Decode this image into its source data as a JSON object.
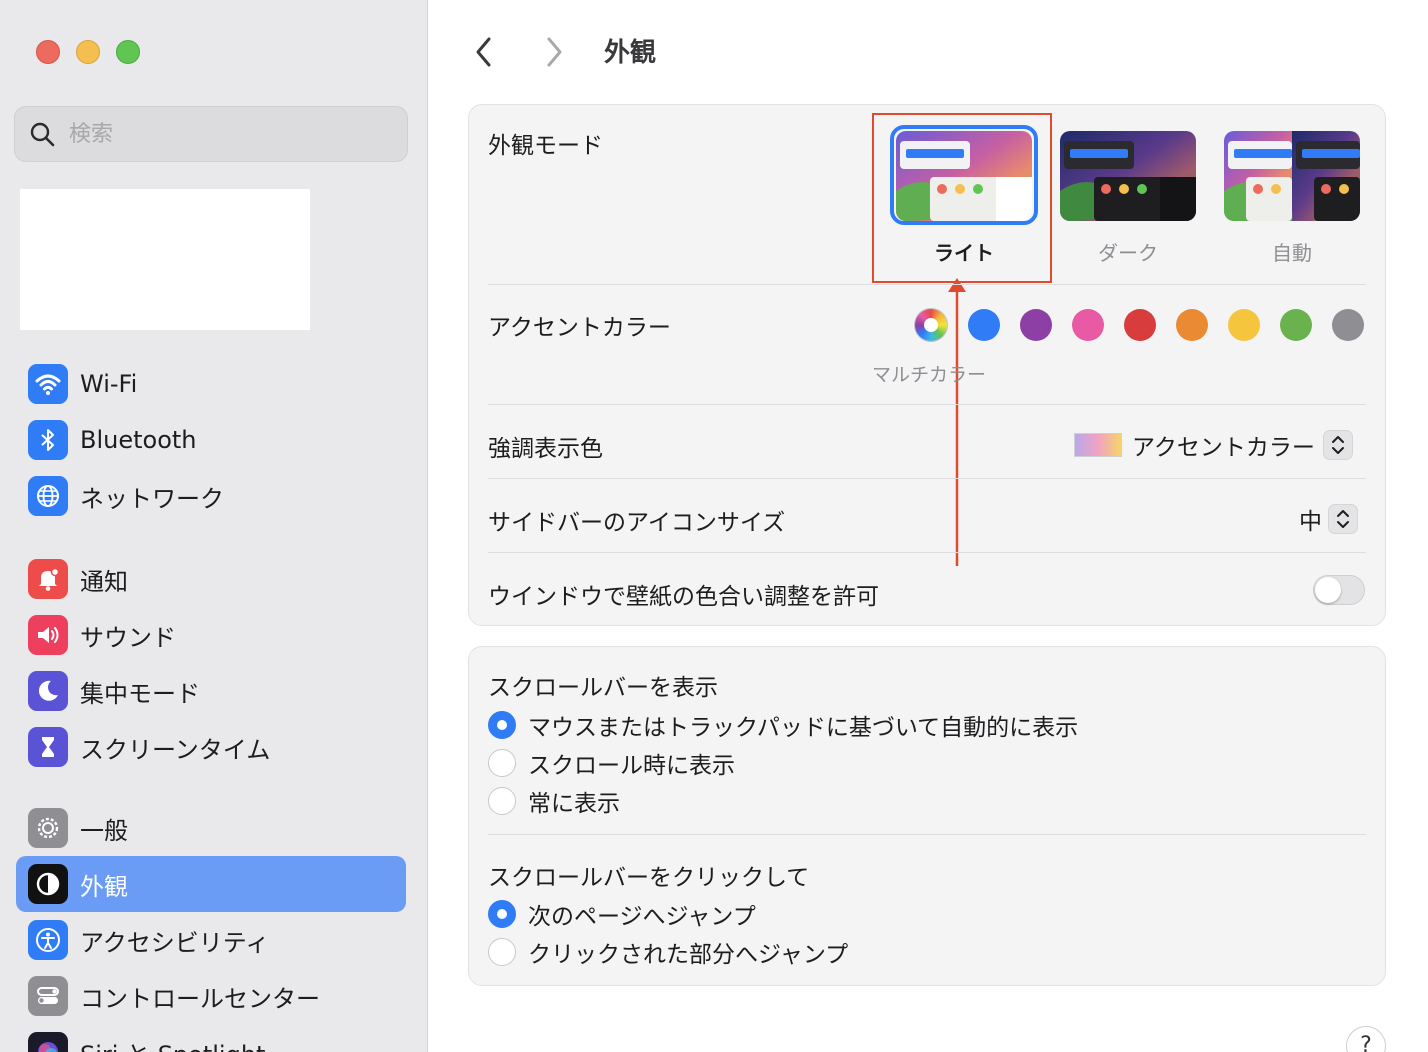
{
  "sidebar": {
    "search_placeholder": "検索",
    "groups": [
      [
        {
          "label": "Wi-Fi",
          "icon": "wifi-icon",
          "color": "#2f7cf6"
        },
        {
          "label": "Bluetooth",
          "icon": "bluetooth-icon",
          "color": "#2f7cf6"
        },
        {
          "label": "ネットワーク",
          "icon": "globe-icon",
          "color": "#2f7cf6"
        }
      ],
      [
        {
          "label": "通知",
          "icon": "bell-icon",
          "color": "#ee4b4b"
        },
        {
          "label": "サウンド",
          "icon": "speaker-icon",
          "color": "#ee3f5f"
        },
        {
          "label": "集中モード",
          "icon": "moon-icon",
          "color": "#5b53d6"
        },
        {
          "label": "スクリーンタイム",
          "icon": "hourglass-icon",
          "color": "#5b53d6"
        }
      ],
      [
        {
          "label": "一般",
          "icon": "gear-icon",
          "color": "#8e8e93"
        },
        {
          "label": "外観",
          "icon": "appearance-icon",
          "color": "#111111",
          "active": true
        },
        {
          "label": "アクセシビリティ",
          "icon": "accessibility-icon",
          "color": "#2f7cf6"
        },
        {
          "label": "コントロールセンター",
          "icon": "toggles-icon",
          "color": "#8e8e93"
        },
        {
          "label": "Siri と Spotlight",
          "icon": "siri-icon",
          "color": "#1a1a2a"
        }
      ]
    ]
  },
  "header": {
    "title": "外観"
  },
  "appearance": {
    "mode_label": "外観モード",
    "modes": [
      {
        "label": "ライト",
        "selected": true
      },
      {
        "label": "ダーク",
        "selected": false
      },
      {
        "label": "自動",
        "selected": false
      }
    ],
    "accent_label": "アクセントカラー",
    "accent_selected_name": "マルチカラー",
    "accent_colors": [
      "multicolor",
      "#2f7cf6",
      "#8e3fa6",
      "#e85aa3",
      "#d83c3c",
      "#ea8a33",
      "#f5c53e",
      "#6ab24e",
      "#8e8e93"
    ],
    "highlight_label": "強調表示色",
    "highlight_value": "アクセントカラー",
    "sidebar_icon_label": "サイドバーのアイコンサイズ",
    "sidebar_icon_value": "中",
    "tinting_label": "ウインドウで壁紙の色合い調整を許可",
    "tinting_on": false
  },
  "scrollbars": {
    "show_label": "スクロールバーを表示",
    "show_options": [
      {
        "label": "マウスまたはトラックパッドに基づいて自動的に表示",
        "selected": true
      },
      {
        "label": "スクロール時に表示",
        "selected": false
      },
      {
        "label": "常に表示",
        "selected": false
      }
    ],
    "click_label": "スクロールバーをクリックして",
    "click_options": [
      {
        "label": "次のページへジャンプ",
        "selected": true
      },
      {
        "label": "クリックされた部分へジャンプ",
        "selected": false
      }
    ]
  },
  "help_label": "?",
  "annotation": {
    "color": "#e04a2f"
  }
}
